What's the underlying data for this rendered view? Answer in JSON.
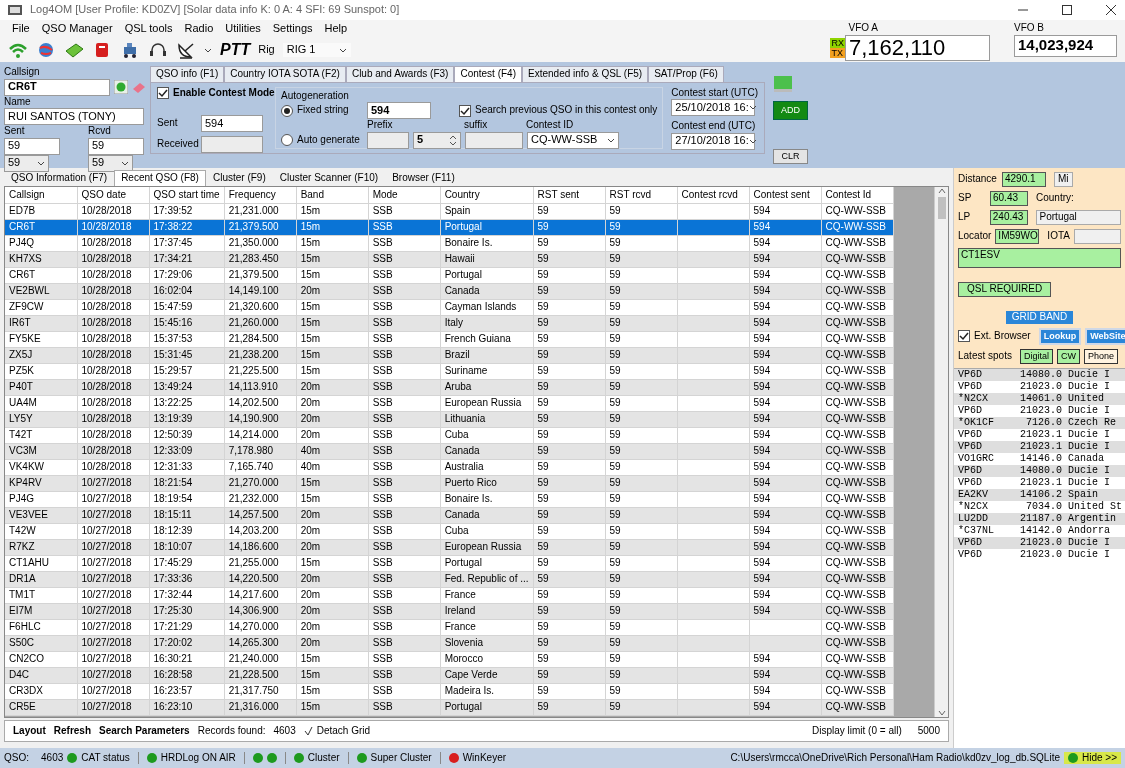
{
  "window": {
    "title": "Log4OM [User Profile: KD0ZV] [Solar data info K: 0 A: 4 SFI: 69 Sunspot: 0]"
  },
  "menu": [
    "File",
    "QSO Manager",
    "QSL tools",
    "Radio",
    "Utilities",
    "Settings",
    "Help"
  ],
  "toolbar": {
    "ptt": "PTT",
    "rig_label": "Rig",
    "rig": "RIG 1"
  },
  "vfo_a": {
    "label": "VFO A",
    "rx": "RX",
    "tx": "TX",
    "frequency": "7,162,110"
  },
  "vfo_b": {
    "label": "VFO B",
    "frequency": "14,023,924"
  },
  "entry": {
    "callsign_label": "Callsign",
    "callsign": "CR6T",
    "name_label": "Name",
    "name": "RUI SANTOS (TONY)",
    "sent_label": "Sent",
    "sent": "59",
    "sent_select": "59",
    "rcvd_label": "Rcvd",
    "rcvd": "59",
    "rcvd_select": "59"
  },
  "info_tabs": [
    {
      "label": "QSO info (F1)",
      "selected": false
    },
    {
      "label": "Country IOTA SOTA (F2)",
      "selected": false
    },
    {
      "label": "Club and Awards (F3)",
      "selected": false
    },
    {
      "label": "Contest (F4)",
      "selected": true
    },
    {
      "label": "Extended info & QSL (F5)",
      "selected": false
    },
    {
      "label": "SAT/Prop (F6)",
      "selected": false
    }
  ],
  "contest": {
    "enable_label": "Enable Contest Mode",
    "enabled": true,
    "sent_label": "Sent",
    "sent": "594",
    "received_label": "Received",
    "autogeneration_label": "Autogeneration",
    "modes": [
      {
        "label": "Fixed string",
        "selected": true
      },
      {
        "label": "Auto generate",
        "selected": false
      }
    ],
    "fixed_string": "594",
    "prefix_label": "Prefix",
    "number": "5",
    "suffix_label": "suffix",
    "search_label": "Search previous QSO in this contest only",
    "search_checked": true,
    "contest_id_label": "Contest ID",
    "contest_id": "CQ-WW-SSB",
    "start_label": "Contest start (UTC)",
    "start": "25/10/2018 16:",
    "end_label": "Contest end (UTC)",
    "end": "27/10/2018 16:"
  },
  "actions": {
    "add": "ADD",
    "clr": "CLR"
  },
  "main_tabs": [
    {
      "label": "QSO Information (F7)",
      "selected": false
    },
    {
      "label": "Recent QSO (F8)",
      "selected": true
    },
    {
      "label": "Cluster (F9)",
      "selected": false
    },
    {
      "label": "Cluster Scanner (F10)",
      "selected": false
    },
    {
      "label": "Browser (F11)",
      "selected": false
    }
  ],
  "table": {
    "columns": [
      "Callsign",
      "QSO date",
      "QSO start time",
      "Frequency",
      "Band",
      "Mode",
      "Country",
      "RST sent",
      "RST rcvd",
      "Contest rcvd",
      "Contest sent",
      "Contest Id"
    ],
    "rows": [
      {
        "callsign": "ED7B",
        "date": "10/28/2018",
        "time": "17:39:52",
        "frequency": "21,231.000",
        "band": "15m",
        "mode": "SSB",
        "country": "Spain",
        "rst_sent": "59",
        "rst_rcvd": "59",
        "contest_sent": "594",
        "contest_id": "CQ-WW-SSB",
        "selected": false
      },
      {
        "callsign": "CR6T",
        "date": "10/28/2018",
        "time": "17:38:22",
        "frequency": "21,379.500",
        "band": "15m",
        "mode": "SSB",
        "country": "Portugal",
        "rst_sent": "59",
        "rst_rcvd": "59",
        "contest_sent": "594",
        "contest_id": "CQ-WW-SSB",
        "selected": true
      },
      {
        "callsign": "PJ4Q",
        "date": "10/28/2018",
        "time": "17:37:45",
        "frequency": "21,350.000",
        "band": "15m",
        "mode": "SSB",
        "country": "Bonaire Is.",
        "rst_sent": "59",
        "rst_rcvd": "59",
        "contest_sent": "594",
        "contest_id": "CQ-WW-SSB",
        "selected": false
      },
      {
        "callsign": "KH7XS",
        "date": "10/28/2018",
        "time": "17:34:21",
        "frequency": "21,283.450",
        "band": "15m",
        "mode": "SSB",
        "country": "Hawaii",
        "rst_sent": "59",
        "rst_rcvd": "59",
        "contest_sent": "594",
        "contest_id": "CQ-WW-SSB",
        "selected": false
      },
      {
        "callsign": "CR6T",
        "date": "10/28/2018",
        "time": "17:29:06",
        "frequency": "21,379.500",
        "band": "15m",
        "mode": "SSB",
        "country": "Portugal",
        "rst_sent": "59",
        "rst_rcvd": "59",
        "contest_sent": "594",
        "contest_id": "CQ-WW-SSB",
        "selected": false
      },
      {
        "callsign": "VE2BWL",
        "date": "10/28/2018",
        "time": "16:02:04",
        "frequency": "14,149.100",
        "band": "20m",
        "mode": "SSB",
        "country": "Canada",
        "rst_sent": "59",
        "rst_rcvd": "59",
        "contest_sent": "594",
        "contest_id": "CQ-WW-SSB",
        "selected": false
      },
      {
        "callsign": "ZF9CW",
        "date": "10/28/2018",
        "time": "15:47:59",
        "frequency": "21,320.600",
        "band": "15m",
        "mode": "SSB",
        "country": "Cayman Islands",
        "rst_sent": "59",
        "rst_rcvd": "59",
        "contest_sent": "594",
        "contest_id": "CQ-WW-SSB",
        "selected": false
      },
      {
        "callsign": "IR6T",
        "date": "10/28/2018",
        "time": "15:45:16",
        "frequency": "21,260.000",
        "band": "15m",
        "mode": "SSB",
        "country": "Italy",
        "rst_sent": "59",
        "rst_rcvd": "59",
        "contest_sent": "594",
        "contest_id": "CQ-WW-SSB",
        "selected": false
      },
      {
        "callsign": "FY5KE",
        "date": "10/28/2018",
        "time": "15:37:53",
        "frequency": "21,284.500",
        "band": "15m",
        "mode": "SSB",
        "country": "French Guiana",
        "rst_sent": "59",
        "rst_rcvd": "59",
        "contest_sent": "594",
        "contest_id": "CQ-WW-SSB",
        "selected": false
      },
      {
        "callsign": "ZX5J",
        "date": "10/28/2018",
        "time": "15:31:45",
        "frequency": "21,238.200",
        "band": "15m",
        "mode": "SSB",
        "country": "Brazil",
        "rst_sent": "59",
        "rst_rcvd": "59",
        "contest_sent": "594",
        "contest_id": "CQ-WW-SSB",
        "selected": false
      },
      {
        "callsign": "PZ5K",
        "date": "10/28/2018",
        "time": "15:29:57",
        "frequency": "21,225.500",
        "band": "15m",
        "mode": "SSB",
        "country": "Suriname",
        "rst_sent": "59",
        "rst_rcvd": "59",
        "contest_sent": "594",
        "contest_id": "CQ-WW-SSB",
        "selected": false
      },
      {
        "callsign": "P40T",
        "date": "10/28/2018",
        "time": "13:49:24",
        "frequency": "14,113.910",
        "band": "20m",
        "mode": "SSB",
        "country": "Aruba",
        "rst_sent": "59",
        "rst_rcvd": "59",
        "contest_sent": "594",
        "contest_id": "CQ-WW-SSB",
        "selected": false
      },
      {
        "callsign": "UA4M",
        "date": "10/28/2018",
        "time": "13:22:25",
        "frequency": "14,202.500",
        "band": "20m",
        "mode": "SSB",
        "country": "European Russia",
        "rst_sent": "59",
        "rst_rcvd": "59",
        "contest_sent": "594",
        "contest_id": "CQ-WW-SSB",
        "selected": false
      },
      {
        "callsign": "LY5Y",
        "date": "10/28/2018",
        "time": "13:19:39",
        "frequency": "14,190.900",
        "band": "20m",
        "mode": "SSB",
        "country": "Lithuania",
        "rst_sent": "59",
        "rst_rcvd": "59",
        "contest_sent": "594",
        "contest_id": "CQ-WW-SSB",
        "selected": false
      },
      {
        "callsign": "T42T",
        "date": "10/28/2018",
        "time": "12:50:39",
        "frequency": "14,214.000",
        "band": "20m",
        "mode": "SSB",
        "country": "Cuba",
        "rst_sent": "59",
        "rst_rcvd": "59",
        "contest_sent": "594",
        "contest_id": "CQ-WW-SSB",
        "selected": false
      },
      {
        "callsign": "VC3M",
        "date": "10/28/2018",
        "time": "12:33:09",
        "frequency": "7,178.980",
        "band": "40m",
        "mode": "SSB",
        "country": "Canada",
        "rst_sent": "59",
        "rst_rcvd": "59",
        "contest_sent": "594",
        "contest_id": "CQ-WW-SSB",
        "selected": false
      },
      {
        "callsign": "VK4KW",
        "date": "10/28/2018",
        "time": "12:31:33",
        "frequency": "7,165.740",
        "band": "40m",
        "mode": "SSB",
        "country": "Australia",
        "rst_sent": "59",
        "rst_rcvd": "59",
        "contest_sent": "594",
        "contest_id": "CQ-WW-SSB",
        "selected": false
      },
      {
        "callsign": "KP4RV",
        "date": "10/27/2018",
        "time": "18:21:54",
        "frequency": "21,270.000",
        "band": "15m",
        "mode": "SSB",
        "country": "Puerto Rico",
        "rst_sent": "59",
        "rst_rcvd": "59",
        "contest_sent": "594",
        "contest_id": "CQ-WW-SSB",
        "selected": false
      },
      {
        "callsign": "PJ4G",
        "date": "10/27/2018",
        "time": "18:19:54",
        "frequency": "21,232.000",
        "band": "15m",
        "mode": "SSB",
        "country": "Bonaire Is.",
        "rst_sent": "59",
        "rst_rcvd": "59",
        "contest_sent": "594",
        "contest_id": "CQ-WW-SSB",
        "selected": false
      },
      {
        "callsign": "VE3VEE",
        "date": "10/27/2018",
        "time": "18:15:11",
        "frequency": "14,257.500",
        "band": "20m",
        "mode": "SSB",
        "country": "Canada",
        "rst_sent": "59",
        "rst_rcvd": "59",
        "contest_sent": "594",
        "contest_id": "CQ-WW-SSB",
        "selected": false
      },
      {
        "callsign": "T42W",
        "date": "10/27/2018",
        "time": "18:12:39",
        "frequency": "14,203.200",
        "band": "20m",
        "mode": "SSB",
        "country": "Cuba",
        "rst_sent": "59",
        "rst_rcvd": "59",
        "contest_sent": "594",
        "contest_id": "CQ-WW-SSB",
        "selected": false
      },
      {
        "callsign": "R7KZ",
        "date": "10/27/2018",
        "time": "18:10:07",
        "frequency": "14,186.600",
        "band": "20m",
        "mode": "SSB",
        "country": "European Russia",
        "rst_sent": "59",
        "rst_rcvd": "59",
        "contest_sent": "594",
        "contest_id": "CQ-WW-SSB",
        "selected": false
      },
      {
        "callsign": "CT1AHU",
        "date": "10/27/2018",
        "time": "17:45:29",
        "frequency": "21,255.000",
        "band": "15m",
        "mode": "SSB",
        "country": "Portugal",
        "rst_sent": "59",
        "rst_rcvd": "59",
        "contest_sent": "594",
        "contest_id": "CQ-WW-SSB",
        "selected": false
      },
      {
        "callsign": "DR1A",
        "date": "10/27/2018",
        "time": "17:33:36",
        "frequency": "14,220.500",
        "band": "20m",
        "mode": "SSB",
        "country": "Fed. Republic of ...",
        "rst_sent": "59",
        "rst_rcvd": "59",
        "contest_sent": "594",
        "contest_id": "CQ-WW-SSB",
        "selected": false
      },
      {
        "callsign": "TM1T",
        "date": "10/27/2018",
        "time": "17:32:44",
        "frequency": "14,217.600",
        "band": "20m",
        "mode": "SSB",
        "country": "France",
        "rst_sent": "59",
        "rst_rcvd": "59",
        "contest_sent": "594",
        "contest_id": "CQ-WW-SSB",
        "selected": false
      },
      {
        "callsign": "EI7M",
        "date": "10/27/2018",
        "time": "17:25:30",
        "frequency": "14,306.900",
        "band": "20m",
        "mode": "SSB",
        "country": "Ireland",
        "rst_sent": "59",
        "rst_rcvd": "59",
        "contest_sent": "594",
        "contest_id": "CQ-WW-SSB",
        "selected": false
      },
      {
        "callsign": "F6HLC",
        "date": "10/27/2018",
        "time": "17:21:29",
        "frequency": "14,270.000",
        "band": "20m",
        "mode": "SSB",
        "country": "France",
        "rst_sent": "59",
        "rst_rcvd": "59",
        "contest_id": "CQ-WW-SSB",
        "selected": false
      },
      {
        "callsign": "S50C",
        "date": "10/27/2018",
        "time": "17:20:02",
        "frequency": "14,265.300",
        "band": "20m",
        "mode": "SSB",
        "country": "Slovenia",
        "rst_sent": "59",
        "rst_rcvd": "59",
        "contest_id": "CQ-WW-SSB",
        "selected": false
      },
      {
        "callsign": "CN2CO",
        "date": "10/27/2018",
        "time": "16:30:21",
        "frequency": "21,240.000",
        "band": "15m",
        "mode": "SSB",
        "country": "Morocco",
        "rst_sent": "59",
        "rst_rcvd": "59",
        "contest_sent": "594",
        "contest_id": "CQ-WW-SSB",
        "selected": false
      },
      {
        "callsign": "D4C",
        "date": "10/27/2018",
        "time": "16:28:58",
        "frequency": "21,228.500",
        "band": "15m",
        "mode": "SSB",
        "country": "Cape Verde",
        "rst_sent": "59",
        "rst_rcvd": "59",
        "contest_sent": "594",
        "contest_id": "CQ-WW-SSB",
        "selected": false
      },
      {
        "callsign": "CR3DX",
        "date": "10/27/2018",
        "time": "16:23:57",
        "frequency": "21,317.750",
        "band": "15m",
        "mode": "SSB",
        "country": "Madeira Is.",
        "rst_sent": "59",
        "rst_rcvd": "59",
        "contest_sent": "594",
        "contest_id": "CQ-WW-SSB",
        "selected": false
      },
      {
        "callsign": "CR5E",
        "date": "10/27/2018",
        "time": "16:23:10",
        "frequency": "21,316.000",
        "band": "15m",
        "mode": "SSB",
        "country": "Portugal",
        "rst_sent": "59",
        "rst_rcvd": "59",
        "contest_sent": "594",
        "contest_id": "CQ-WW-SSB",
        "selected": false
      }
    ]
  },
  "grid_footer": {
    "layout": "Layout",
    "refresh": "Refresh",
    "search": "Search Parameters",
    "records_label": "Records found:",
    "records": "4603",
    "detach": "Detach Grid",
    "limit_label": "Display limit (0 = all)",
    "limit": "5000"
  },
  "details": {
    "distance_label": "Distance",
    "distance": "4290.1",
    "unit": "Mi",
    "sp_label": "SP",
    "sp": "60.43",
    "country_label": "Country:",
    "country": "Portugal",
    "lp_label": "LP",
    "lp": "240.43",
    "locator_label": "Locator",
    "locator": "IM59WO",
    "iota_label": "IOTA",
    "qsl_manager": "CT1ESV",
    "qsl_status": "QSL REQUIRED",
    "grid_band": "GRID BAND",
    "ext_browser_label": "Ext. Browser",
    "ext_browser": true,
    "lookup": "Lookup",
    "website": "WebSite",
    "spots_label": "Latest spots",
    "spot_filters": [
      {
        "label": "Digital",
        "on": true
      },
      {
        "label": "CW",
        "on": true
      },
      {
        "label": "Phone",
        "on": false
      }
    ]
  },
  "spots": [
    {
      "call": "VP6D",
      "frequency": "14080.0",
      "country": "Ducie I"
    },
    {
      "call": "VP6D",
      "frequency": "21023.0",
      "country": "Ducie I"
    },
    {
      "call": "*N2CX",
      "frequency": "14061.0",
      "country": "United"
    },
    {
      "call": "VP6D",
      "frequency": "21023.0",
      "country": "Ducie I"
    },
    {
      "call": "*OK1CF",
      "frequency": "7126.0",
      "country": "Czech Re"
    },
    {
      "call": "VP6D",
      "frequency": "21023.1",
      "country": "Ducie I"
    },
    {
      "call": "VP6D",
      "frequency": "21023.1",
      "country": "Ducie I"
    },
    {
      "call": "VO1GRC",
      "frequency": "14146.0",
      "country": "Canada"
    },
    {
      "call": "VP6D",
      "frequency": "14080.0",
      "country": "Ducie I"
    },
    {
      "call": "VP6D",
      "frequency": "21023.1",
      "country": "Ducie I"
    },
    {
      "call": "EA2KV",
      "frequency": "14106.2",
      "country": "Spain"
    },
    {
      "call": "*N2CX",
      "frequency": "7034.0",
      "country": "United St"
    },
    {
      "call": "LU2DD",
      "frequency": "21187.0",
      "country": "Argentin"
    },
    {
      "call": "*C37NL",
      "frequency": "14142.0",
      "country": "Andorra"
    },
    {
      "call": "VP6D",
      "frequency": "21023.0",
      "country": "Ducie I"
    },
    {
      "call": "VP6D",
      "frequency": "21023.0",
      "country": "Ducie I"
    }
  ],
  "status_bar": {
    "qso_label": "QSO:",
    "qso": "4603",
    "groups": [
      {
        "lights": [
          {
            "color": "#1e9a1e"
          }
        ],
        "label": "CAT status"
      },
      {
        "lights": [
          {
            "color": "#1e9a1e"
          }
        ],
        "label": "HRDLog ON AIR"
      },
      {
        "lights": [
          {
            "color": "#1e9a1e"
          },
          {
            "color": "#1e9a1e"
          }
        ]
      },
      {
        "lights": [
          {
            "color": "#1e9a1e"
          }
        ],
        "label": "Cluster"
      },
      {
        "lights": [
          {
            "color": "#1e9a1e"
          }
        ],
        "label": "Super Cluster"
      },
      {
        "lights": [
          {
            "color": "#d81e1e"
          }
        ],
        "label": "WinKeyer"
      }
    ],
    "path": "C:\\Users\\rmcca\\OneDrive\\Rich Personal\\Ham Radio\\kd0zv_log_db.SQLite",
    "hide": "Hide >>"
  }
}
